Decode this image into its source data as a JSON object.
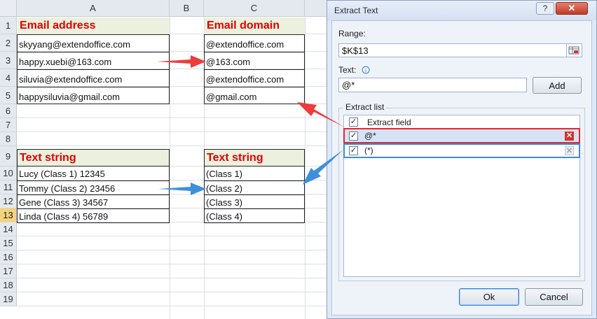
{
  "spreadsheet": {
    "columns": [
      "A",
      "B",
      "C"
    ],
    "rows": [
      "1",
      "2",
      "3",
      "4",
      "5",
      "6",
      "7",
      "8",
      "9",
      "10",
      "11",
      "12",
      "13",
      "14",
      "15",
      "16",
      "17",
      "18",
      "19"
    ],
    "email_header": "Email address",
    "emails": [
      "skyyang@extendoffice.com",
      "happy.xuebi@163.com",
      "siluvia@extendoffice.com",
      "happysiluvia@gmail.com"
    ],
    "domain_header": "Email domain",
    "domains": [
      "@extendoffice.com",
      "@163.com",
      "@extendoffice.com",
      "@gmail.com"
    ],
    "text_header_a": "Text string",
    "text_strings": [
      "Lucy (Class 1) 12345",
      "Tommy (Class 2) 23456",
      "Gene (Class 3) 34567",
      "Linda (Class 4) 56789"
    ],
    "text_header_c": "Text string",
    "class_results": [
      "(Class 1)",
      "(Class 2)",
      "(Class 3)",
      "(Class 4)"
    ]
  },
  "dialog": {
    "title": "Extract Text",
    "help": "?",
    "close": "✕",
    "range_label": "Range:",
    "range_value": "$K$13",
    "text_label": "Text:",
    "text_value": "@*",
    "add_label": "Add",
    "list_label": "Extract list",
    "list_header": "Extract field",
    "items": [
      "@*",
      "(*)"
    ],
    "ok_label": "Ok",
    "cancel_label": "Cancel"
  },
  "colors": {
    "header_text": "#e00000",
    "header_fill": "#ebf1de",
    "red_arrow": "#ee3b3b",
    "blue_arrow": "#3d8fdc",
    "red_highlight": "#e5282d",
    "blue_highlight": "#3a8dd8"
  }
}
